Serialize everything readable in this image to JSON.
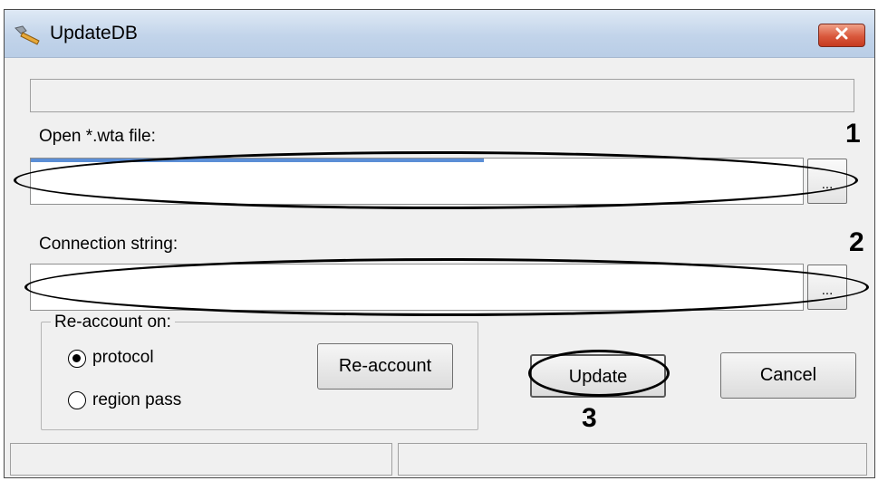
{
  "window": {
    "title": "UpdateDB",
    "icon": "wrench-icon",
    "close_icon": "close-icon"
  },
  "file_section": {
    "label": "Open *.wta file:",
    "value": "",
    "browse_label": "...",
    "marker": "1"
  },
  "connection_section": {
    "label": "Connection string:",
    "value": "",
    "browse_label": "...",
    "marker": "2"
  },
  "reaccount_group": {
    "label": "Re-account on:",
    "options": [
      {
        "label": "protocol",
        "selected": true
      },
      {
        "label": "region pass",
        "selected": false
      }
    ],
    "button_label": "Re-account"
  },
  "actions": {
    "update_label": "Update",
    "update_marker": "3",
    "cancel_label": "Cancel"
  },
  "colors": {
    "titlebar": "#c2d4ea",
    "close_button": "#d9583c",
    "window_bg": "#f0f0f0"
  }
}
